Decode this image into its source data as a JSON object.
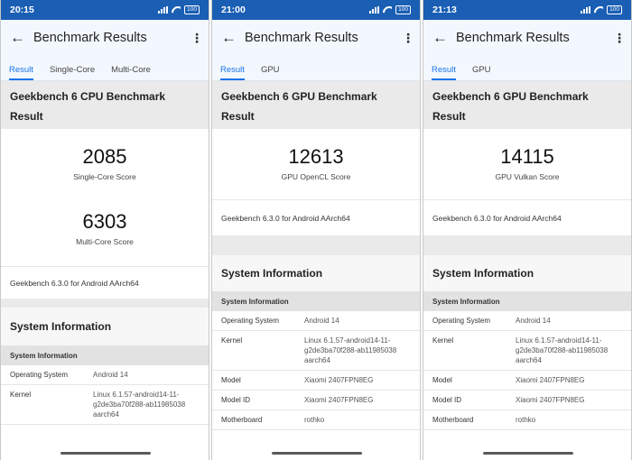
{
  "app": {
    "title": "Benchmark Results",
    "back_icon": "arrow-back-icon",
    "menu_icon": "more-vert-icon"
  },
  "colors": {
    "status_bar": "#1a5fb4",
    "accent": "#1a73e8",
    "app_bar_bg": "#f3f8ff",
    "section_bg": "#eaeaea"
  },
  "screens": [
    {
      "status": {
        "time": "20:15",
        "battery": "100"
      },
      "tabs": [
        {
          "label": "Result",
          "active": true
        },
        {
          "label": "Single-Core",
          "active": false
        },
        {
          "label": "Multi-Core",
          "active": false
        }
      ],
      "benchmark_title": "Geekbench 6 CPU Benchmark",
      "result_label": "Result",
      "scores": [
        {
          "value": "2085",
          "label": "Single-Core Score"
        },
        {
          "value": "6303",
          "label": "Multi-Core Score"
        }
      ],
      "version": "Geekbench 6.3.0 for Android AArch64",
      "system_info_title": "System Information",
      "system_info_subhead": "System Information",
      "rows": [
        {
          "key": "Operating System",
          "value": "Android 14"
        },
        {
          "key": "Kernel",
          "value": "Linux 6.1.57-android14-11-g2de3ba70f288-ab11985038 aarch64"
        }
      ]
    },
    {
      "status": {
        "time": "21:00",
        "battery": "100"
      },
      "tabs": [
        {
          "label": "Result",
          "active": true
        },
        {
          "label": "GPU",
          "active": false
        }
      ],
      "benchmark_title": "Geekbench 6 GPU Benchmark",
      "result_label": "Result",
      "scores": [
        {
          "value": "12613",
          "label": "GPU OpenCL Score"
        }
      ],
      "version": "Geekbench 6.3.0 for Android AArch64",
      "system_info_title": "System Information",
      "system_info_subhead": "System Information",
      "rows": [
        {
          "key": "Operating System",
          "value": "Android 14"
        },
        {
          "key": "Kernel",
          "value": "Linux 6.1.57-android14-11-g2de3ba70f288-ab11985038 aarch64"
        },
        {
          "key": "Model",
          "value": "Xiaomi 2407FPN8EG"
        },
        {
          "key": "Model ID",
          "value": "Xiaomi 2407FPN8EG"
        },
        {
          "key": "Motherboard",
          "value": "rothko"
        }
      ]
    },
    {
      "status": {
        "time": "21:13",
        "battery": "100"
      },
      "tabs": [
        {
          "label": "Result",
          "active": true
        },
        {
          "label": "GPU",
          "active": false
        }
      ],
      "benchmark_title": "Geekbench 6 GPU Benchmark",
      "result_label": "Result",
      "scores": [
        {
          "value": "14115",
          "label": "GPU Vulkan Score"
        }
      ],
      "version": "Geekbench 6.3.0 for Android AArch64",
      "system_info_title": "System Information",
      "system_info_subhead": "System Information",
      "rows": [
        {
          "key": "Operating System",
          "value": "Android 14"
        },
        {
          "key": "Kernel",
          "value": "Linux 6.1.57-android14-11-g2de3ba70f288-ab11985038 aarch64"
        },
        {
          "key": "Model",
          "value": "Xiaomi 2407FPN8EG"
        },
        {
          "key": "Model ID",
          "value": "Xiaomi 2407FPN8EG"
        },
        {
          "key": "Motherboard",
          "value": "rothko"
        }
      ]
    }
  ]
}
